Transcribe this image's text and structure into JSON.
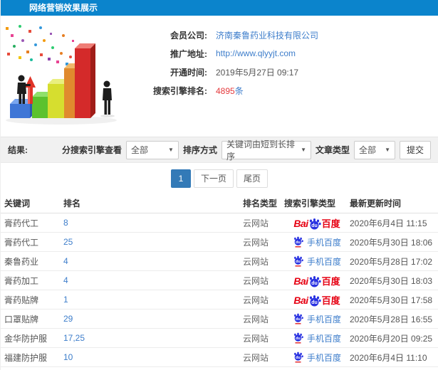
{
  "window": {
    "title": "网络营销效果展示"
  },
  "info": {
    "company_label": "会员公司:",
    "company_value": "济南秦鲁药业科技有限公司",
    "url_label": "推广地址:",
    "url_value": "http://www.qlyyjt.com",
    "opened_label": "开通时间:",
    "opened_value": "2019年5月27日 09:17",
    "rank_label": "搜索引擎排名:",
    "rank_value": "4895",
    "rank_unit": "条"
  },
  "filters": {
    "result_label": "结果:",
    "engine_label": "分搜索引擎查看",
    "engine_value": "全部",
    "sort_label": "排序方式",
    "sort_value": "关键词由短到长排序",
    "article_label": "文章类型",
    "article_value": "全部",
    "submit_label": "提交"
  },
  "pagination": {
    "current": "1",
    "next": "下一页",
    "last": "尾页"
  },
  "table": {
    "headers": [
      "关键词",
      "排名",
      "排名类型",
      "搜索引擎类型",
      "最新更新时间"
    ],
    "engine": {
      "pc_bai": "Bai",
      "pc_du": "du",
      "pc_cn": "百度",
      "mobile_du": "du",
      "mobile_label": "手机百度"
    },
    "rows": [
      {
        "keyword": "膏药代工",
        "rank": "8",
        "rank_type": "云网站",
        "engine": "baidu",
        "updated": "2020年6月4日 11:15"
      },
      {
        "keyword": "膏药代工",
        "rank": "25",
        "rank_type": "云网站",
        "engine": "mobile",
        "updated": "2020年5月30日 18:06"
      },
      {
        "keyword": "秦鲁药业",
        "rank": "4",
        "rank_type": "云网站",
        "engine": "mobile",
        "updated": "2020年5月28日 17:02"
      },
      {
        "keyword": "膏药加工",
        "rank": "4",
        "rank_type": "云网站",
        "engine": "baidu",
        "updated": "2020年5月30日 18:03"
      },
      {
        "keyword": "膏药贴牌",
        "rank": "1",
        "rank_type": "云网站",
        "engine": "baidu",
        "updated": "2020年5月30日 17:58"
      },
      {
        "keyword": "口罩贴牌",
        "rank": "29",
        "rank_type": "云网站",
        "engine": "mobile",
        "updated": "2020年5月28日 16:55"
      },
      {
        "keyword": "金华防护服",
        "rank": "17,25",
        "rank_type": "云网站",
        "engine": "mobile",
        "updated": "2020年6月20日 09:25"
      },
      {
        "keyword": "福建防护服",
        "rank": "10",
        "rank_type": "云网站",
        "engine": "mobile",
        "updated": "2020年6月4日 11:10"
      }
    ]
  },
  "colors": {
    "header_bg": "#0b84cc",
    "link": "#3e7ecb",
    "highlight_red": "#e4393c",
    "page_active": "#337ab7",
    "baidu_red": "#e60012",
    "baidu_blue": "#2932e1"
  }
}
